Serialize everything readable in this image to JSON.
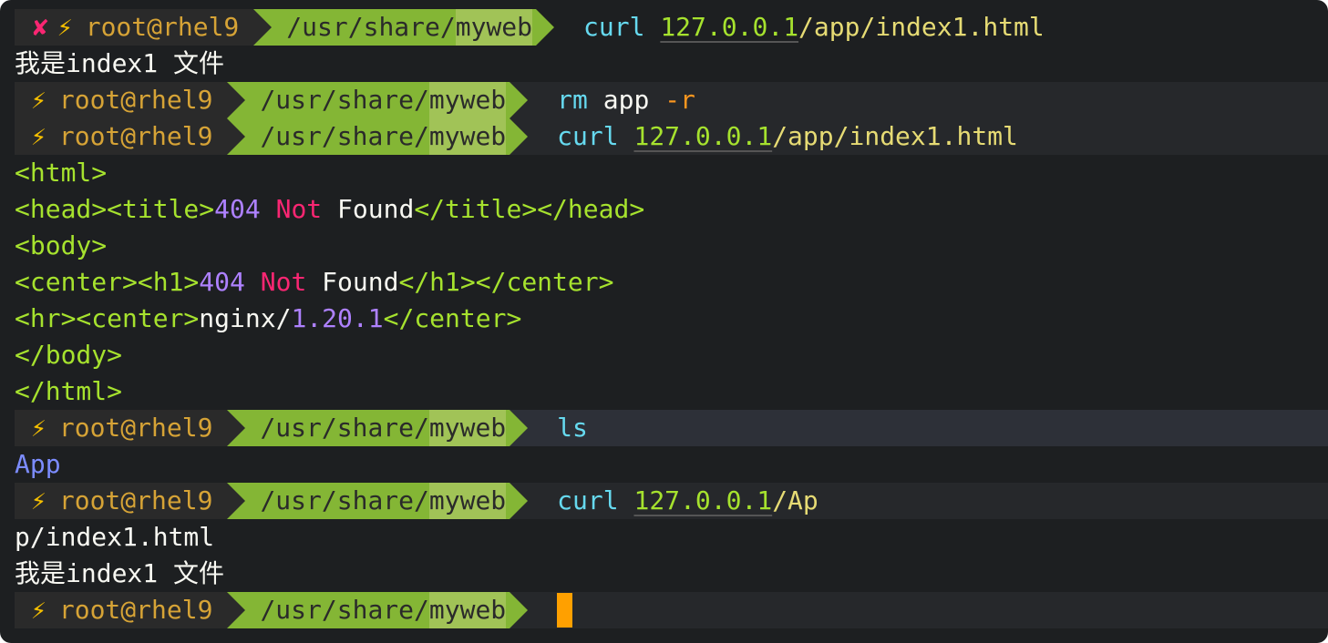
{
  "top_prompt": {
    "status_icon": "x-icon",
    "bolt": "⚡",
    "x": "✘",
    "user": "root@rhel9",
    "path_prefix": "/usr/share/",
    "path_hl": "myweb",
    "cmd": "curl",
    "url": "127.0.0.1",
    "url_rest": "/app/index1.html"
  },
  "output1": "我是index1 文件",
  "prompt": {
    "bolt": "⚡",
    "user": "root@rhel9",
    "path_prefix": "/usr/share/",
    "path_hl": "myweb"
  },
  "cmd2": {
    "cmd": "rm",
    "arg": " app ",
    "flag": "-r"
  },
  "cmd3": {
    "cmd": "curl",
    "url": "127.0.0.1",
    "url_rest": "/app/index1.html"
  },
  "html_out": [
    {
      "a": "<html>"
    },
    {
      "a": "<head><title>",
      "n": "404",
      "r": " Not",
      "b": " Found",
      "c": "</title></head>"
    },
    {
      "a": "<body>"
    },
    {
      "a": "<center><h1>",
      "n": "404",
      "r": " Not",
      "b": " Found",
      "c": "</h1></center>"
    },
    {
      "a": "<hr><center>",
      "b": "nginx/",
      "n": "1.20.1",
      "c": "</center>"
    },
    {
      "a": "</body>"
    },
    {
      "a": "</html>"
    }
  ],
  "cmd4": {
    "cmd": "ls"
  },
  "ls_out": "App",
  "cmd5": {
    "cmd": "curl",
    "url": "127.0.0.1",
    "url_rest": "/Ap"
  },
  "wrap_out": "p/index1.html",
  "output2": "我是index1 文件"
}
